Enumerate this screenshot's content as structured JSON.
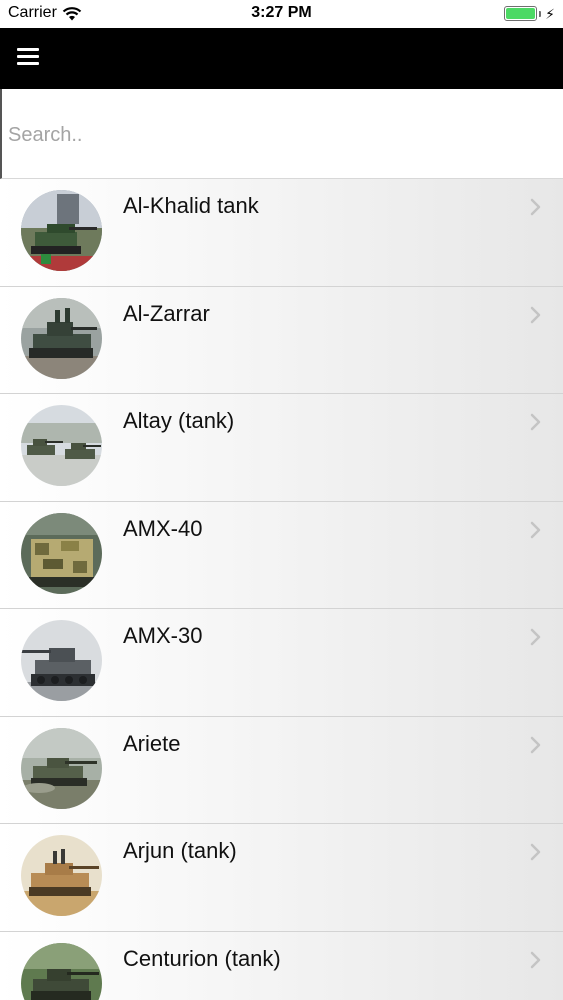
{
  "status_bar": {
    "carrier": "Carrier",
    "time": "3:27 PM"
  },
  "search": {
    "placeholder": "Search.."
  },
  "items": [
    {
      "label": "Al-Khalid tank"
    },
    {
      "label": "Al-Zarrar"
    },
    {
      "label": "Altay (tank)"
    },
    {
      "label": "AMX-40"
    },
    {
      "label": "AMX-30"
    },
    {
      "label": "Ariete"
    },
    {
      "label": "Arjun (tank)"
    },
    {
      "label": "Centurion (tank)"
    }
  ],
  "colors": {
    "nav_bar": "#000000",
    "battery": "#4cd964"
  },
  "icons": {
    "menu": "hamburger-icon",
    "wifi": "wifi-icon",
    "chevron": "chevron-right-icon"
  }
}
